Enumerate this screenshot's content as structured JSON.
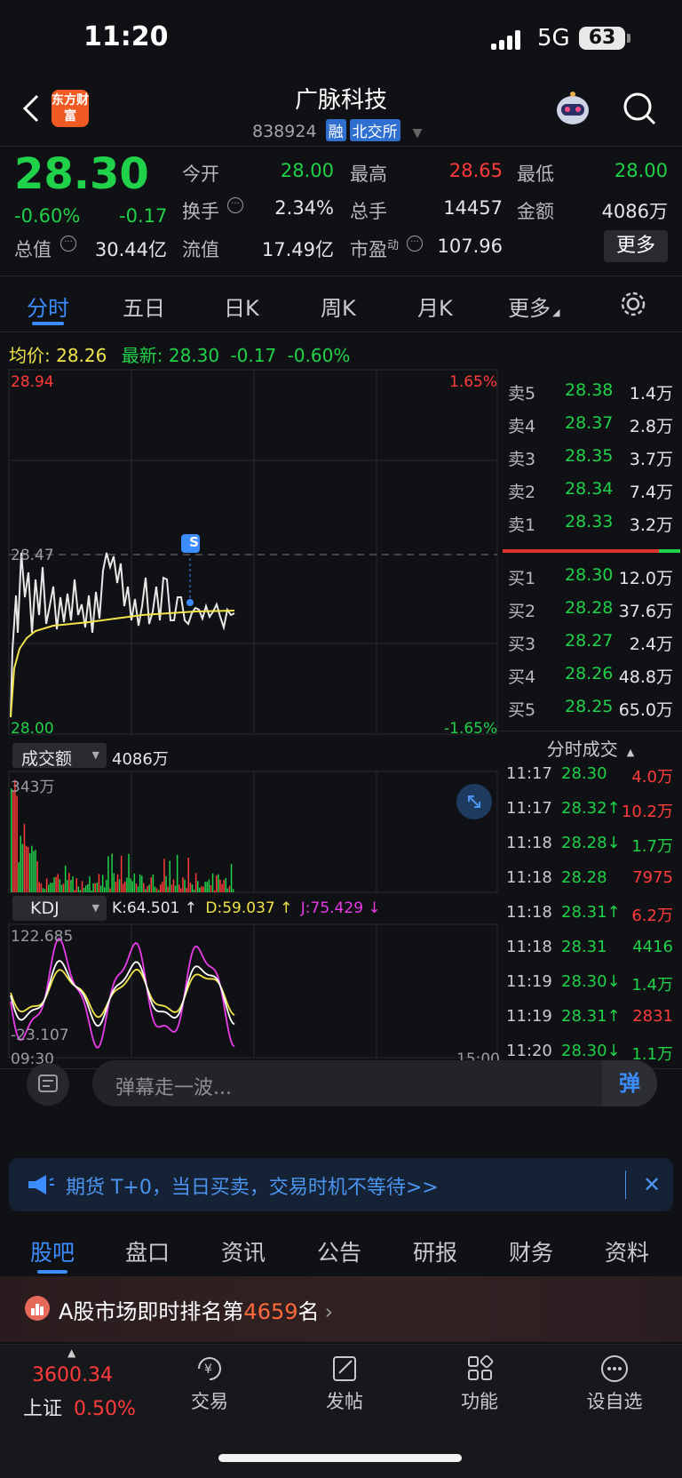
{
  "status": {
    "time": "11:20",
    "network": "5G",
    "battery": "63"
  },
  "header": {
    "logo_text": "东方财富",
    "title": "广脉科技",
    "code": "838924",
    "tag1": "融",
    "tag2": "北交所"
  },
  "quote": {
    "price": "28.30",
    "change_pct": "-0.60%",
    "change": "-0.17",
    "open_label": "今开",
    "open": "28.00",
    "high_label": "最高",
    "high": "28.65",
    "low_label": "最低",
    "low": "28.00",
    "turnover_label": "换手",
    "turnover": "2.34%",
    "vol_label": "总手",
    "vol": "14457",
    "amount_label": "金额",
    "amount": "4086万",
    "mktcap_label": "总值",
    "mktcap": "30.44亿",
    "float_label": "流值",
    "float": "17.49亿",
    "pe_label": "市盈",
    "pe_sup": "动",
    "pe": "107.96",
    "more": "更多"
  },
  "tabs": [
    "分时",
    "五日",
    "日K",
    "周K",
    "月K",
    "更多"
  ],
  "chart_info": {
    "avg_label": "均价:",
    "avg": "28.26",
    "latest_label": "最新:",
    "latest": "28.30",
    "chg": "-0.17",
    "chg_pct": "-0.60%"
  },
  "chart_labels": {
    "ymax": "28.94",
    "ymid": "28.47",
    "ymin": "28.00",
    "pct_max": "1.65%",
    "pct_min": "-1.65%",
    "marker": "S",
    "vol_indicator": "成交额",
    "vol_value": "4086万",
    "vol_max": "343万",
    "kdj_indicator": "KDJ",
    "k": "K:64.501 ↑",
    "d": "D:59.037 ↑",
    "j": "J:75.429 ↓",
    "kdj_max": "122.685",
    "kdj_min": "-23.107",
    "t_start": "09:30",
    "t_end": "15:00"
  },
  "orderbook": {
    "asks": [
      {
        "label": "卖5",
        "price": "28.38",
        "vol": "1.4万"
      },
      {
        "label": "卖4",
        "price": "28.37",
        "vol": "2.8万"
      },
      {
        "label": "卖3",
        "price": "28.35",
        "vol": "3.7万"
      },
      {
        "label": "卖2",
        "price": "28.34",
        "vol": "7.4万"
      },
      {
        "label": "卖1",
        "price": "28.33",
        "vol": "3.2万"
      }
    ],
    "bids": [
      {
        "label": "买1",
        "price": "28.30",
        "vol": "12.0万"
      },
      {
        "label": "买2",
        "price": "28.28",
        "vol": "37.6万"
      },
      {
        "label": "买3",
        "price": "28.27",
        "vol": "2.4万"
      },
      {
        "label": "买4",
        "price": "28.26",
        "vol": "48.8万"
      },
      {
        "label": "买5",
        "price": "28.25",
        "vol": "65.0万"
      }
    ],
    "trades_title": "分时成交",
    "trades": [
      {
        "time": "11:17",
        "price": "28.30",
        "vol": "4.0万",
        "pc": "green",
        "vc": "red"
      },
      {
        "time": "11:17",
        "price": "28.32↑",
        "vol": "10.2万",
        "pc": "green",
        "vc": "red"
      },
      {
        "time": "11:18",
        "price": "28.28↓",
        "vol": "1.7万",
        "pc": "green",
        "vc": "green"
      },
      {
        "time": "11:18",
        "price": "28.28",
        "vol": "7975",
        "pc": "green",
        "vc": "red"
      },
      {
        "time": "11:18",
        "price": "28.31↑",
        "vol": "6.2万",
        "pc": "green",
        "vc": "red"
      },
      {
        "time": "11:18",
        "price": "28.31",
        "vol": "4416",
        "pc": "green",
        "vc": "green"
      },
      {
        "time": "11:19",
        "price": "28.30↓",
        "vol": "1.4万",
        "pc": "green",
        "vc": "green"
      },
      {
        "time": "11:19",
        "price": "28.31↑",
        "vol": "2831",
        "pc": "green",
        "vc": "red"
      },
      {
        "time": "11:20",
        "price": "28.30↓",
        "vol": "1.1万",
        "pc": "green",
        "vc": "green"
      }
    ]
  },
  "danmu": {
    "placeholder": "弹幕走一波...",
    "btn": "弹"
  },
  "banner": {
    "text": "期货 T+0，当日买卖，交易时机不等待>>"
  },
  "bottom_tabs": [
    "股吧",
    "盘口",
    "资讯",
    "公告",
    "研报",
    "财务",
    "资料"
  ],
  "rank": {
    "prefix": "A股市场即时排名第",
    "num": "4659",
    "suffix": "名"
  },
  "nav": {
    "index_value": "3600.34",
    "index_name": "上证",
    "index_pct": "0.50%",
    "trade": "交易",
    "post": "发帖",
    "func": "功能",
    "fav": "设自选"
  }
}
